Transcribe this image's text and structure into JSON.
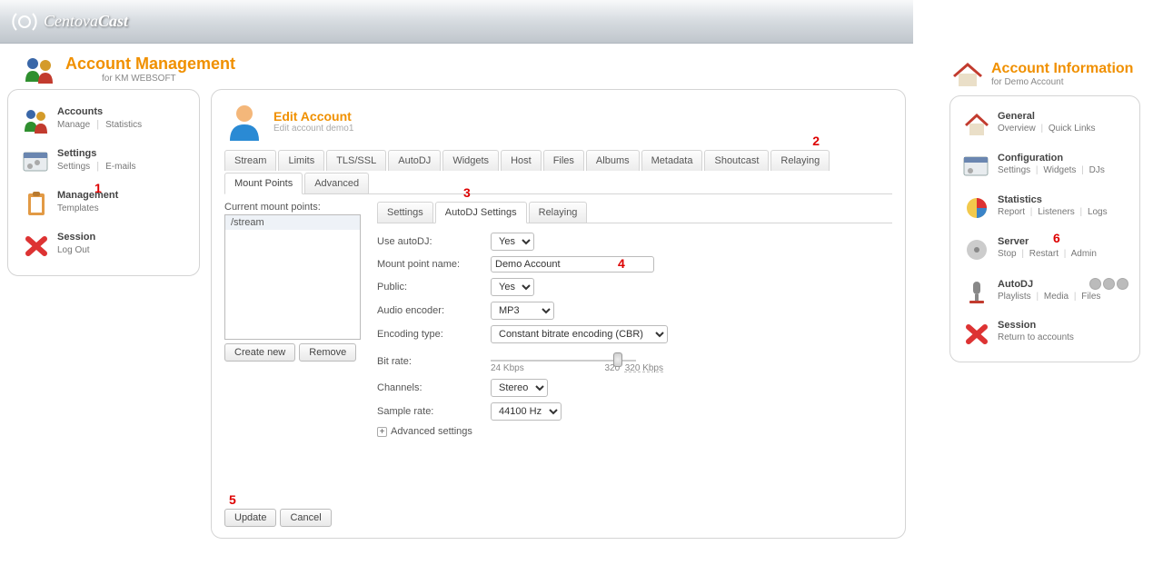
{
  "brand": {
    "name1": "Centova",
    "name2": "Cast"
  },
  "header": {
    "title": "Account Management",
    "subtitle": "for KM WEBSOFT"
  },
  "sidebar": [
    {
      "title": "Accounts",
      "links": [
        "Manage",
        "Statistics"
      ]
    },
    {
      "title": "Settings",
      "links": [
        "Settings",
        "E-mails"
      ]
    },
    {
      "title": "Management",
      "links": [
        "Templates"
      ]
    },
    {
      "title": "Session",
      "links": [
        "Log Out"
      ]
    }
  ],
  "main": {
    "title": "Edit Account",
    "subtitle": "Edit account demo1",
    "tabs": [
      "Stream",
      "Limits",
      "TLS/SSL",
      "AutoDJ",
      "Widgets",
      "Host",
      "Files",
      "Albums",
      "Metadata",
      "Shoutcast",
      "Relaying",
      "Mount Points",
      "Advanced"
    ],
    "active_tab": "Mount Points",
    "mount_list_label": "Current mount points:",
    "mount_items": [
      "/stream"
    ],
    "mount_buttons": {
      "create": "Create new",
      "remove": "Remove"
    },
    "subtabs": [
      "Settings",
      "AutoDJ Settings",
      "Relaying"
    ],
    "active_subtab": "AutoDJ Settings",
    "form": {
      "use_autodj": {
        "label": "Use autoDJ:",
        "options": [
          "Yes"
        ],
        "value": "Yes"
      },
      "mount_name": {
        "label": "Mount point name:",
        "value": "Demo Account"
      },
      "public": {
        "label": "Public:",
        "options": [
          "Yes"
        ],
        "value": "Yes"
      },
      "encoder": {
        "label": "Audio encoder:",
        "options": [
          "MP3"
        ],
        "value": "MP3"
      },
      "enc_type": {
        "label": "Encoding type:",
        "options": [
          "Constant bitrate encoding (CBR)"
        ],
        "value": "Constant bitrate encoding (CBR)"
      },
      "bitrate": {
        "label": "Bit rate:",
        "min": "24 Kbps",
        "cur": "320",
        "cur_k": "320 Kbps"
      },
      "channels": {
        "label": "Channels:",
        "options": [
          "Stereo"
        ],
        "value": "Stereo"
      },
      "sample": {
        "label": "Sample rate:",
        "options": [
          "44100 Hz"
        ],
        "value": "44100 Hz"
      },
      "advanced": "Advanced settings"
    },
    "bottom": {
      "update": "Update",
      "cancel": "Cancel"
    }
  },
  "right": {
    "title": "Account Information",
    "subtitle": "for Demo Account",
    "sections": [
      {
        "title": "General",
        "links": [
          "Overview",
          "Quick Links"
        ]
      },
      {
        "title": "Configuration",
        "links": [
          "Settings",
          "Widgets",
          "DJs"
        ]
      },
      {
        "title": "Statistics",
        "links": [
          "Report",
          "Listeners",
          "Logs"
        ]
      },
      {
        "title": "Server",
        "links": [
          "Stop",
          "Restart",
          "Admin"
        ]
      },
      {
        "title": "AutoDJ",
        "links": [
          "Playlists",
          "Media",
          "Files"
        ]
      },
      {
        "title": "Session",
        "links": [
          "Return to accounts"
        ]
      }
    ]
  },
  "annotations": {
    "a1": "1",
    "a2": "2",
    "a3": "3",
    "a4": "4",
    "a5": "5",
    "a6": "6"
  }
}
